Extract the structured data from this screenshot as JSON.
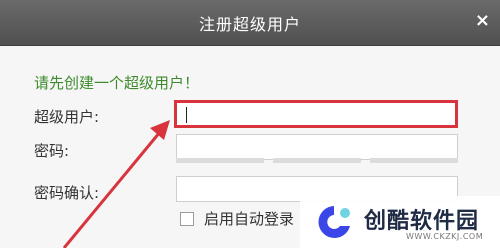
{
  "dialog": {
    "title": "注册超级用户",
    "close_glyph": "×"
  },
  "form": {
    "hint": "请先创建一个超级用户！",
    "username_label": "超级用户:",
    "username_value": "",
    "password_label": "密码:",
    "password_value": "",
    "confirm_label": "密码确认:",
    "confirm_value": "",
    "auto_login_label": "启用自动登录",
    "auto_login_checked": false
  },
  "watermark": {
    "brand": "创酷软件园",
    "url": "WWW.CKZKJ.COM"
  },
  "colors": {
    "titlebar": "#5a5a5a",
    "hint": "#3e8a2e",
    "highlight": "#d8343e",
    "logo_primary": "#3b46e8"
  },
  "icons": [
    "close-icon",
    "brand-logo-icon",
    "annotation-arrow-icon"
  ]
}
